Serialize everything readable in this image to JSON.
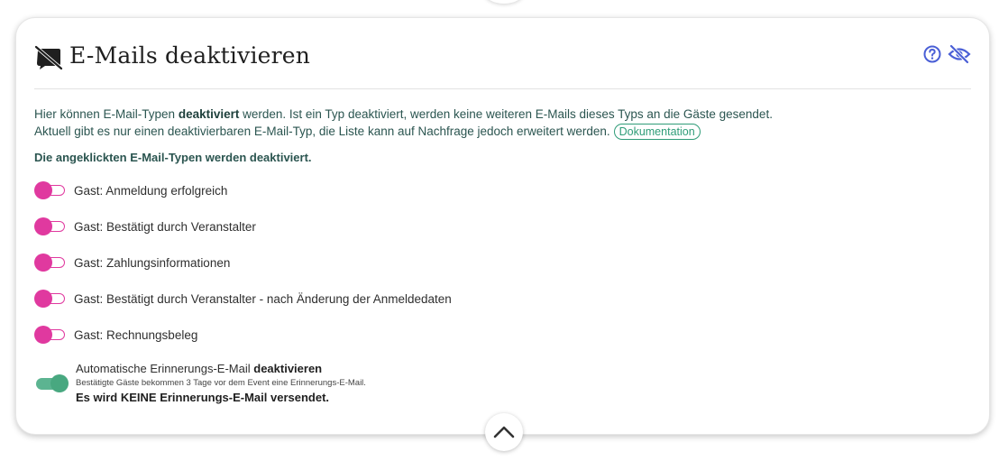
{
  "card": {
    "title": "E-Mails deaktivieren",
    "title_icon": "email-off-icon",
    "header_actions": [
      {
        "name": "help",
        "icon": "help-circle-icon"
      },
      {
        "name": "hide",
        "icon": "eye-off-icon"
      }
    ]
  },
  "intro": {
    "line1_before": "Hier können E-Mail-Typen ",
    "line1_bold": "deaktiviert",
    "line1_after": " werden. Ist ein Typ deaktiviert, werden keine weiteren E-Mails dieses Typs an die Gäste gesendet.",
    "line2": "Aktuell gibt es nur einen deaktivierbaren E-Mail-Typ, die Liste kann auf Nachfrage jedoch erweitert werden.",
    "doc_link": "Dokumentation"
  },
  "section_note": "Die angeklickten E-Mail-Typen werden deaktiviert.",
  "email_types": [
    {
      "label": "Gast: Anmeldung erfolgreich",
      "enabled": false
    },
    {
      "label": "Gast: Bestätigt durch Veranstalter",
      "enabled": false
    },
    {
      "label": "Gast: Zahlungsinformationen",
      "enabled": false
    },
    {
      "label": "Gast: Bestätigt durch Veranstalter - nach Änderung der Anmeldedaten",
      "enabled": false
    },
    {
      "label": "Gast: Rechnungsbeleg",
      "enabled": false
    }
  ],
  "reminder": {
    "label_before": "Automatische Erinnerungs-E-Mail ",
    "label_bold": "deaktivieren",
    "sub": "Bestätigte Gäste bekommen 3 Tage vor dem Event eine Erinnerungs-E-Mail.",
    "warning": "Es wird KEINE Erinnerungs-E-Mail versendet.",
    "enabled": true
  },
  "colors": {
    "accent_pink": "#e0399f",
    "accent_green": "#48a880",
    "link_green": "#2f9c78",
    "text_teal": "#2b5550",
    "icon_blue": "#4a5fd6"
  },
  "collapse_icon": "chevron-up-icon"
}
